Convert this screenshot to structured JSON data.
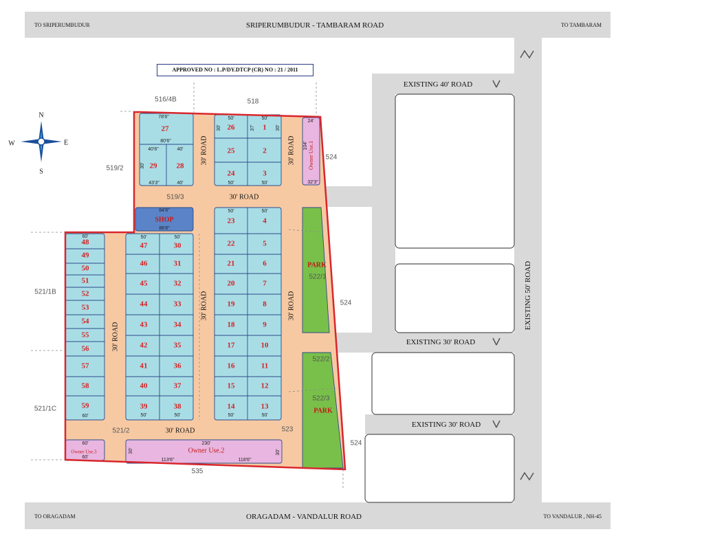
{
  "colors": {
    "road_grey": "#d9d9d9",
    "layout_road": "#f7c9a3",
    "plot_blue": "#a9dde6",
    "park_green": "#79c04a",
    "owner_pink": "#e8b6e0",
    "shop_blue": "#5b84c8",
    "boundary_red": "#d8262c"
  },
  "roads": {
    "top_main": "SRIPERUMBUDUR  -  TAMBARAM  ROAD",
    "top_left": "TO SRIPERUMBUDUR",
    "top_right": "TO TAMBARAM",
    "bottom_main": "ORAGADAM  -  VANDALUR  ROAD",
    "bottom_left": "TO ORAGADAM",
    "bottom_right": "TO VANDALUR , NH-45",
    "existing_40": "EXISTING 40' ROAD",
    "existing_50": "EXISTING 50' ROAD",
    "existing_30_upper": "EXISTING 30' ROAD",
    "existing_30_lower": "EXISTING 30' ROAD",
    "layout_road": "30' ROAD"
  },
  "approval": "APPROVED  NO : L.P/DY.DTCP (CR) NO : 21 / 2011",
  "compass": {
    "n": "N",
    "s": "S",
    "e": "E",
    "w": "W"
  },
  "survey_numbers": {
    "s516": "516/4B",
    "s518": "518",
    "s519_2": "519/2",
    "s519_3": "519/3",
    "s521_1b": "521/1B",
    "s521_1c": "521/1C",
    "s521_2": "521/2",
    "s522_1": "522/1",
    "s522_2": "522/2",
    "s522_3": "522/3",
    "s523": "523",
    "s524_a": "524",
    "s524_b": "524",
    "s524_c": "524",
    "s535": "535"
  },
  "special": {
    "shop": "SHOP",
    "park_upper": "PARK",
    "park_lower": "PARK",
    "owner1": "Owner Use.1",
    "owner2": "Owner Use.2",
    "owner3": "Owner Use.3"
  },
  "plots": {
    "p1": "1",
    "p2": "2",
    "p3": "3",
    "p4": "4",
    "p5": "5",
    "p6": "6",
    "p7": "7",
    "p8": "8",
    "p9": "9",
    "p10": "10",
    "p11": "11",
    "p12": "12",
    "p13": "13",
    "p14": "14",
    "p15": "15",
    "p16": "16",
    "p17": "17",
    "p18": "18",
    "p19": "19",
    "p20": "20",
    "p21": "21",
    "p22": "22",
    "p23": "23",
    "p24": "24",
    "p25": "25",
    "p26": "26",
    "p27": "27",
    "p28": "28",
    "p29": "29",
    "p30": "30",
    "p31": "31",
    "p32": "32",
    "p33": "33",
    "p34": "34",
    "p35": "35",
    "p36": "36",
    "p37": "37",
    "p38": "38",
    "p39": "39",
    "p40": "40",
    "p41": "41",
    "p42": "42",
    "p43": "43",
    "p44": "44",
    "p45": "45",
    "p46": "46",
    "p47": "47",
    "p48": "48",
    "p49": "49",
    "p50": "50",
    "p51": "51",
    "p52": "52",
    "p53": "53",
    "p54": "54",
    "p55": "55",
    "p56": "56",
    "p57": "57",
    "p58": "58",
    "p59": "59"
  },
  "dims": {
    "d78_6": "78'6\"",
    "d80_6": "80'6\"",
    "d40_6": "40'6\"",
    "d40": "40'",
    "d43_3": "43'3\"",
    "d50": "50'",
    "d84_6": "84'6\"",
    "d86_6": "86'6\"",
    "d60": "60'",
    "d230": "230'",
    "d113_6": "113'6\"",
    "d118_6": "118'6\"",
    "d24": "24'",
    "d32_3": "32'3\"",
    "d104": "104'",
    "d30": "30'",
    "d37": "37'"
  }
}
